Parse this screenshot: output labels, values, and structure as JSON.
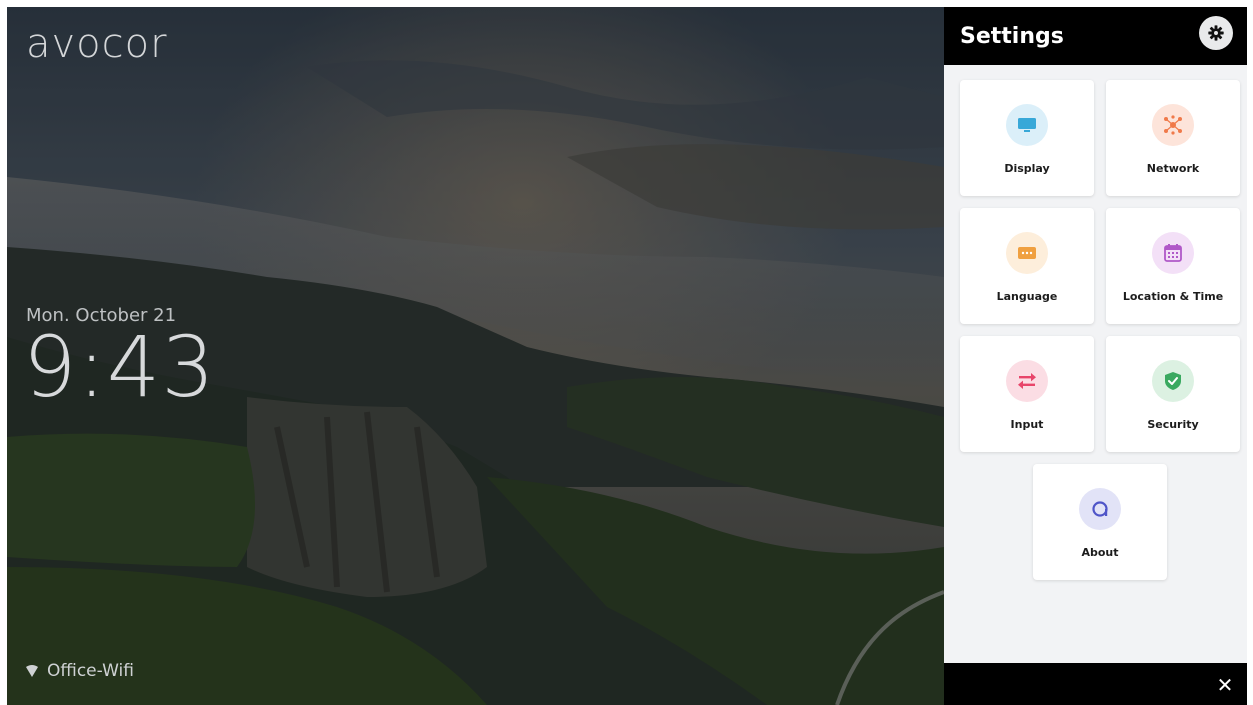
{
  "lockscreen": {
    "brand": "avocor",
    "date": "Mon. October 21",
    "time": "9:43",
    "network": "Office-Wifi"
  },
  "settings": {
    "title": "Settings",
    "tiles": [
      {
        "label": "Display",
        "icon": "monitor-icon",
        "color": "#38a8d8",
        "bg": "#dbeff9"
      },
      {
        "label": "Network",
        "icon": "network-icon",
        "color": "#f07a4a",
        "bg": "#fde4da"
      },
      {
        "label": "Language",
        "icon": "chat-bubble-icon",
        "color": "#f0a040",
        "bg": "#fdeedb"
      },
      {
        "label": "Location & Time",
        "icon": "calendar-icon",
        "color": "#b058c8",
        "bg": "#f3e0f7"
      },
      {
        "label": "Input",
        "icon": "swap-arrows-icon",
        "color": "#e8456a",
        "bg": "#fbdde4"
      },
      {
        "label": "Security",
        "icon": "shield-check-icon",
        "color": "#3aa960",
        "bg": "#dcf1e2"
      },
      {
        "label": "About",
        "icon": "about-logo-icon",
        "color": "#4f55c8",
        "bg": "#e2e3f7"
      }
    ]
  }
}
